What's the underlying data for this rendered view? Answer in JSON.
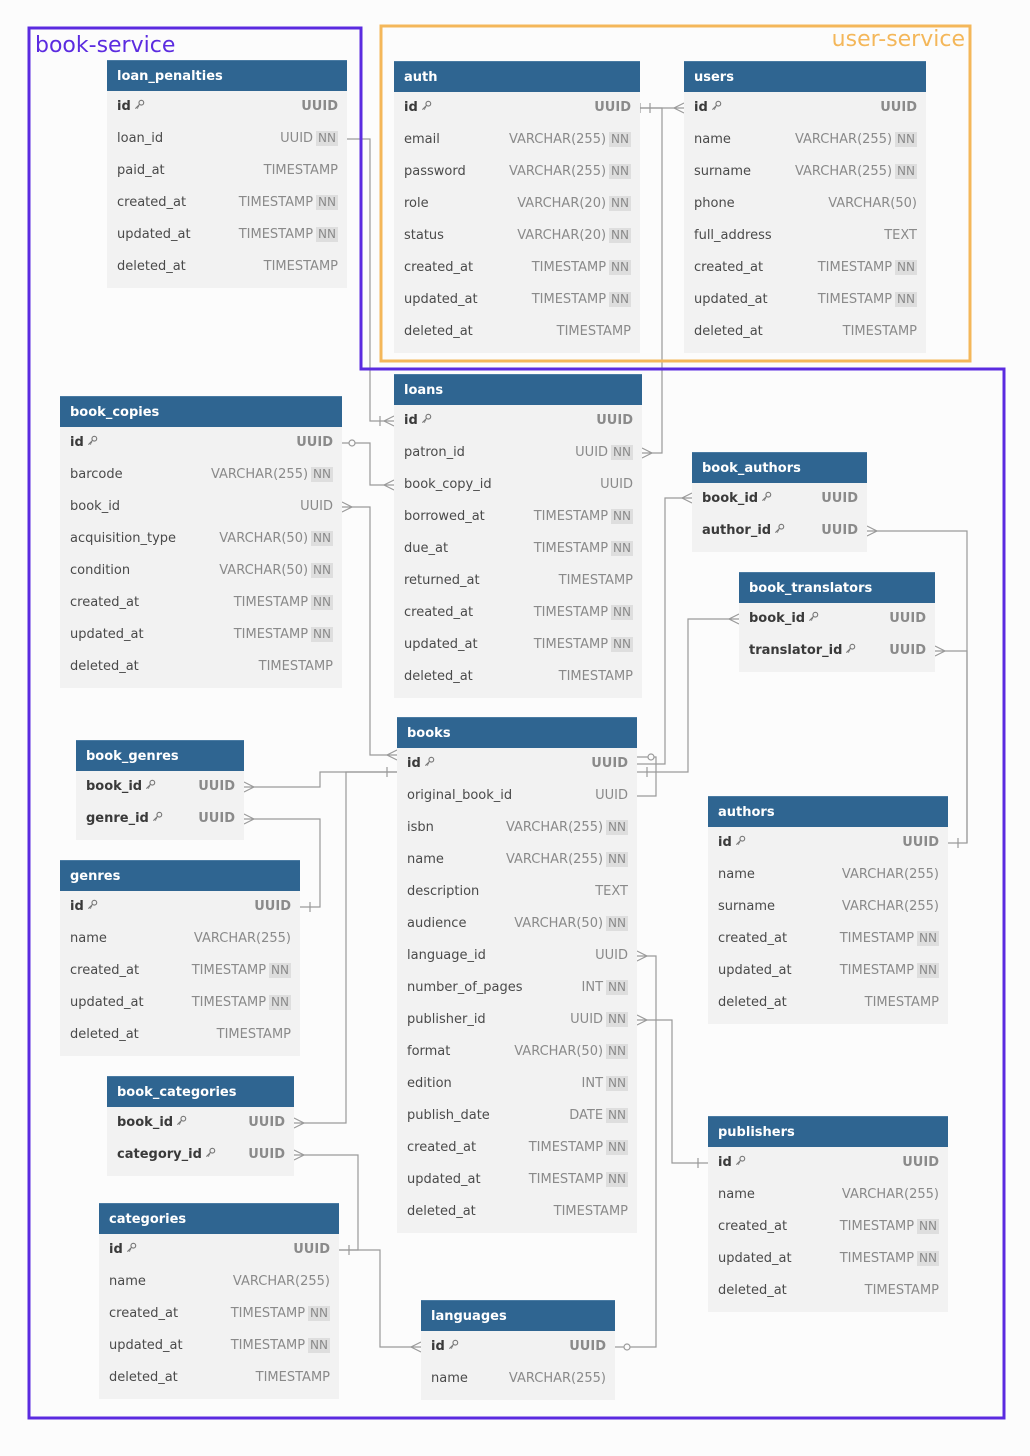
{
  "groups": [
    {
      "name": "book-service",
      "color": "#5b2be0"
    },
    {
      "name": "user-service",
      "color": "#f4b75a"
    }
  ],
  "tables": [
    {
      "name": "loan_penalties",
      "fields": [
        {
          "name": "id",
          "pk": true,
          "type": "UUID"
        },
        {
          "name": "loan_id",
          "type": "UUID",
          "nn": true
        },
        {
          "name": "paid_at",
          "type": "TIMESTAMP"
        },
        {
          "name": "created_at",
          "type": "TIMESTAMP",
          "nn": true
        },
        {
          "name": "updated_at",
          "type": "TIMESTAMP",
          "nn": true
        },
        {
          "name": "deleted_at",
          "type": "TIMESTAMP"
        }
      ]
    },
    {
      "name": "auth",
      "fields": [
        {
          "name": "id",
          "pk": true,
          "type": "UUID"
        },
        {
          "name": "email",
          "type": "VARCHAR(255)",
          "nn": true
        },
        {
          "name": "password",
          "type": "VARCHAR(255)",
          "nn": true
        },
        {
          "name": "role",
          "type": "VARCHAR(20)",
          "nn": true
        },
        {
          "name": "status",
          "type": "VARCHAR(20)",
          "nn": true
        },
        {
          "name": "created_at",
          "type": "TIMESTAMP",
          "nn": true
        },
        {
          "name": "updated_at",
          "type": "TIMESTAMP",
          "nn": true
        },
        {
          "name": "deleted_at",
          "type": "TIMESTAMP"
        }
      ]
    },
    {
      "name": "users",
      "fields": [
        {
          "name": "id",
          "pk": true,
          "type": "UUID"
        },
        {
          "name": "name",
          "type": "VARCHAR(255)",
          "nn": true
        },
        {
          "name": "surname",
          "type": "VARCHAR(255)",
          "nn": true
        },
        {
          "name": "phone",
          "type": "VARCHAR(50)"
        },
        {
          "name": "full_address",
          "type": "TEXT"
        },
        {
          "name": "created_at",
          "type": "TIMESTAMP",
          "nn": true
        },
        {
          "name": "updated_at",
          "type": "TIMESTAMP",
          "nn": true
        },
        {
          "name": "deleted_at",
          "type": "TIMESTAMP"
        }
      ]
    },
    {
      "name": "loans",
      "fields": [
        {
          "name": "id",
          "pk": true,
          "type": "UUID"
        },
        {
          "name": "patron_id",
          "type": "UUID",
          "nn": true
        },
        {
          "name": "book_copy_id",
          "type": "UUID"
        },
        {
          "name": "borrowed_at",
          "type": "TIMESTAMP",
          "nn": true
        },
        {
          "name": "due_at",
          "type": "TIMESTAMP",
          "nn": true
        },
        {
          "name": "returned_at",
          "type": "TIMESTAMP"
        },
        {
          "name": "created_at",
          "type": "TIMESTAMP",
          "nn": true
        },
        {
          "name": "updated_at",
          "type": "TIMESTAMP",
          "nn": true
        },
        {
          "name": "deleted_at",
          "type": "TIMESTAMP"
        }
      ]
    },
    {
      "name": "book_copies",
      "fields": [
        {
          "name": "id",
          "pk": true,
          "type": "UUID"
        },
        {
          "name": "barcode",
          "type": "VARCHAR(255)",
          "nn": true
        },
        {
          "name": "book_id",
          "type": "UUID"
        },
        {
          "name": "acquisition_type",
          "type": "VARCHAR(50)",
          "nn": true
        },
        {
          "name": "condition",
          "type": "VARCHAR(50)",
          "nn": true
        },
        {
          "name": "created_at",
          "type": "TIMESTAMP",
          "nn": true
        },
        {
          "name": "updated_at",
          "type": "TIMESTAMP",
          "nn": true
        },
        {
          "name": "deleted_at",
          "type": "TIMESTAMP"
        }
      ]
    },
    {
      "name": "book_authors",
      "fields": [
        {
          "name": "book_id",
          "pk": true,
          "type": "UUID"
        },
        {
          "name": "author_id",
          "pk": true,
          "type": "UUID"
        }
      ]
    },
    {
      "name": "book_translators",
      "fields": [
        {
          "name": "book_id",
          "pk": true,
          "type": "UUID"
        },
        {
          "name": "translator_id",
          "pk": true,
          "type": "UUID"
        }
      ]
    },
    {
      "name": "book_genres",
      "fields": [
        {
          "name": "book_id",
          "pk": true,
          "type": "UUID"
        },
        {
          "name": "genre_id",
          "pk": true,
          "type": "UUID"
        }
      ]
    },
    {
      "name": "books",
      "fields": [
        {
          "name": "id",
          "pk": true,
          "type": "UUID"
        },
        {
          "name": "original_book_id",
          "type": "UUID"
        },
        {
          "name": "isbn",
          "type": "VARCHAR(255)",
          "nn": true
        },
        {
          "name": "name",
          "type": "VARCHAR(255)",
          "nn": true
        },
        {
          "name": "description",
          "type": "TEXT"
        },
        {
          "name": "audience",
          "type": "VARCHAR(50)",
          "nn": true
        },
        {
          "name": "language_id",
          "type": "UUID"
        },
        {
          "name": "number_of_pages",
          "type": "INT",
          "nn": true
        },
        {
          "name": "publisher_id",
          "type": "UUID",
          "nn": true
        },
        {
          "name": "format",
          "type": "VARCHAR(50)",
          "nn": true
        },
        {
          "name": "edition",
          "type": "INT",
          "nn": true
        },
        {
          "name": "publish_date",
          "type": "DATE",
          "nn": true
        },
        {
          "name": "created_at",
          "type": "TIMESTAMP",
          "nn": true
        },
        {
          "name": "updated_at",
          "type": "TIMESTAMP",
          "nn": true
        },
        {
          "name": "deleted_at",
          "type": "TIMESTAMP"
        }
      ]
    },
    {
      "name": "authors",
      "fields": [
        {
          "name": "id",
          "pk": true,
          "type": "UUID"
        },
        {
          "name": "name",
          "type": "VARCHAR(255)"
        },
        {
          "name": "surname",
          "type": "VARCHAR(255)"
        },
        {
          "name": "created_at",
          "type": "TIMESTAMP",
          "nn": true
        },
        {
          "name": "updated_at",
          "type": "TIMESTAMP",
          "nn": true
        },
        {
          "name": "deleted_at",
          "type": "TIMESTAMP"
        }
      ]
    },
    {
      "name": "genres",
      "fields": [
        {
          "name": "id",
          "pk": true,
          "type": "UUID"
        },
        {
          "name": "name",
          "type": "VARCHAR(255)"
        },
        {
          "name": "created_at",
          "type": "TIMESTAMP",
          "nn": true
        },
        {
          "name": "updated_at",
          "type": "TIMESTAMP",
          "nn": true
        },
        {
          "name": "deleted_at",
          "type": "TIMESTAMP"
        }
      ]
    },
    {
      "name": "book_categories",
      "fields": [
        {
          "name": "book_id",
          "pk": true,
          "type": "UUID"
        },
        {
          "name": "category_id",
          "pk": true,
          "type": "UUID"
        }
      ]
    },
    {
      "name": "publishers",
      "fields": [
        {
          "name": "id",
          "pk": true,
          "type": "UUID"
        },
        {
          "name": "name",
          "type": "VARCHAR(255)"
        },
        {
          "name": "created_at",
          "type": "TIMESTAMP",
          "nn": true
        },
        {
          "name": "updated_at",
          "type": "TIMESTAMP",
          "nn": true
        },
        {
          "name": "deleted_at",
          "type": "TIMESTAMP"
        }
      ]
    },
    {
      "name": "categories",
      "fields": [
        {
          "name": "id",
          "pk": true,
          "type": "UUID"
        },
        {
          "name": "name",
          "type": "VARCHAR(255)"
        },
        {
          "name": "created_at",
          "type": "TIMESTAMP",
          "nn": true
        },
        {
          "name": "updated_at",
          "type": "TIMESTAMP",
          "nn": true
        },
        {
          "name": "deleted_at",
          "type": "TIMESTAMP"
        }
      ]
    },
    {
      "name": "languages",
      "fields": [
        {
          "name": "id",
          "pk": true,
          "type": "UUID"
        },
        {
          "name": "name",
          "type": "VARCHAR(255)"
        }
      ]
    }
  ],
  "relations": [
    {
      "from": "loan_penalties.loan_id",
      "to": "loans.id"
    },
    {
      "from": "loans.patron_id",
      "to": "auth.id"
    },
    {
      "from": "users.id",
      "to": "auth.id"
    },
    {
      "from": "loans.book_copy_id",
      "to": "book_copies.id"
    },
    {
      "from": "book_copies.book_id",
      "to": "books.id"
    },
    {
      "from": "book_authors.book_id",
      "to": "books.id"
    },
    {
      "from": "book_translators.book_id",
      "to": "books.id"
    },
    {
      "from": "book_genres.book_id",
      "to": "books.id"
    },
    {
      "from": "book_genres.genre_id",
      "to": "genres.id"
    },
    {
      "from": "book_categories.book_id",
      "to": "books.id"
    },
    {
      "from": "book_categories.category_id",
      "to": "categories.id"
    },
    {
      "from": "books.original_book_id",
      "to": "books.id"
    },
    {
      "from": "book_authors.author_id",
      "to": "authors.id"
    },
    {
      "from": "book_translators.translator_id",
      "to": "authors.id"
    },
    {
      "from": "books.publisher_id",
      "to": "publishers.id"
    },
    {
      "from": "books.language_id",
      "to": "languages.id"
    }
  ]
}
